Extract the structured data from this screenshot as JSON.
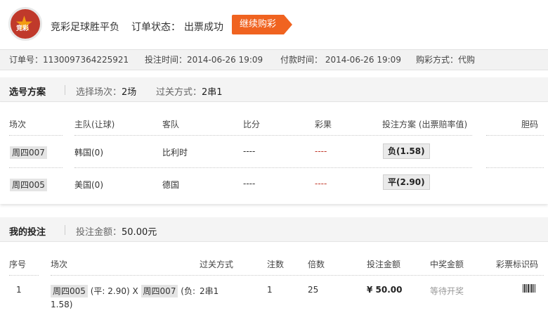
{
  "header": {
    "logo_text": "竞彩",
    "title": "竞彩足球胜平负",
    "status_label": "订单状态：",
    "status": "出票成功",
    "continue_button": "继续购彩"
  },
  "info": {
    "order_no": "订单号：1130097364225921",
    "bet_time": "投注时间：2014-06-26 19:09",
    "pay_time": "付款时间： 2014-06-26 19:09",
    "buy_method": "购彩方式：代购"
  },
  "selection": {
    "title": "选号方案",
    "matches_label": "选择场次：",
    "matches_value": "2场",
    "pass_label": "过关方式：",
    "pass_value": "2串1",
    "columns": [
      "场次",
      "主队(让球)",
      "客队",
      "比分",
      "彩果",
      "投注方案 (出票赔率值)",
      "胆码"
    ],
    "rows": [
      {
        "match": "周四007",
        "home": "韩国(0)",
        "away": "比利时",
        "score": "----",
        "result": "----",
        "bet": "负(1.58)"
      },
      {
        "match": "周四005",
        "home": "美国(0)",
        "away": "德国",
        "score": "----",
        "result": "----",
        "bet": "平(2.90)"
      }
    ]
  },
  "mybet": {
    "title": "我的投注",
    "amount_label": "投注金额：",
    "amount_value": "50.00元",
    "columns": [
      "序号",
      "场次",
      "过关方式",
      "注数",
      "倍数",
      "投注金额",
      "中奖金额",
      "彩票标识码"
    ],
    "row": {
      "index": "1",
      "m1": "周四005",
      "m1_odds": "(平: 2.90) X",
      "m2": "周四007",
      "m2_odds_a": "(负:",
      "m2_odds_b": "1.58)",
      "pass": "2串1",
      "bets": "1",
      "multiple": "25",
      "amount": "¥ 50.00",
      "prize": "等待开奖"
    }
  }
}
